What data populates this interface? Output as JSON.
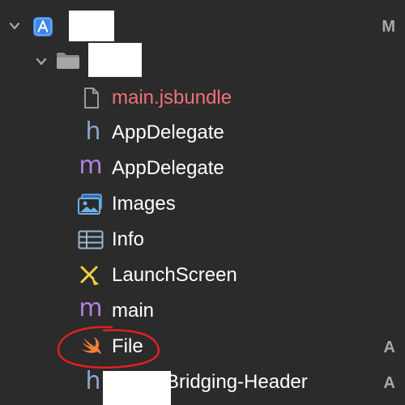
{
  "tree": {
    "project": {
      "status": "M",
      "icon": "app-project-icon"
    },
    "group": {
      "icon": "folder-icon"
    },
    "files": [
      {
        "name": "main.jsbundle",
        "icon": "document-icon",
        "color": "#f07178"
      },
      {
        "name": "AppDelegate",
        "icon": "header-h-icon",
        "glyph": "h",
        "glyph_color": "#8aa6c8"
      },
      {
        "name": "AppDelegate",
        "icon": "objc-m-icon",
        "glyph": "m",
        "glyph_color": "#b080e0"
      },
      {
        "name": "Images",
        "icon": "asset-catalog-icon"
      },
      {
        "name": "Info",
        "icon": "plist-table-icon"
      },
      {
        "name": "LaunchScreen",
        "icon": "storyboard-icon"
      },
      {
        "name": "main",
        "icon": "objc-m-icon",
        "glyph": "m",
        "glyph_color": "#b080e0"
      },
      {
        "name": "File",
        "icon": "swift-icon",
        "status": "A"
      },
      {
        "name": "Bridging-Header",
        "icon": "header-h-icon",
        "glyph": "h",
        "glyph_color": "#8aa6c8",
        "status": "A"
      }
    ]
  },
  "colors": {
    "background": "#2b2b2b",
    "annotation_circle": "#e02020",
    "status_gray": "#a8a8a8"
  }
}
